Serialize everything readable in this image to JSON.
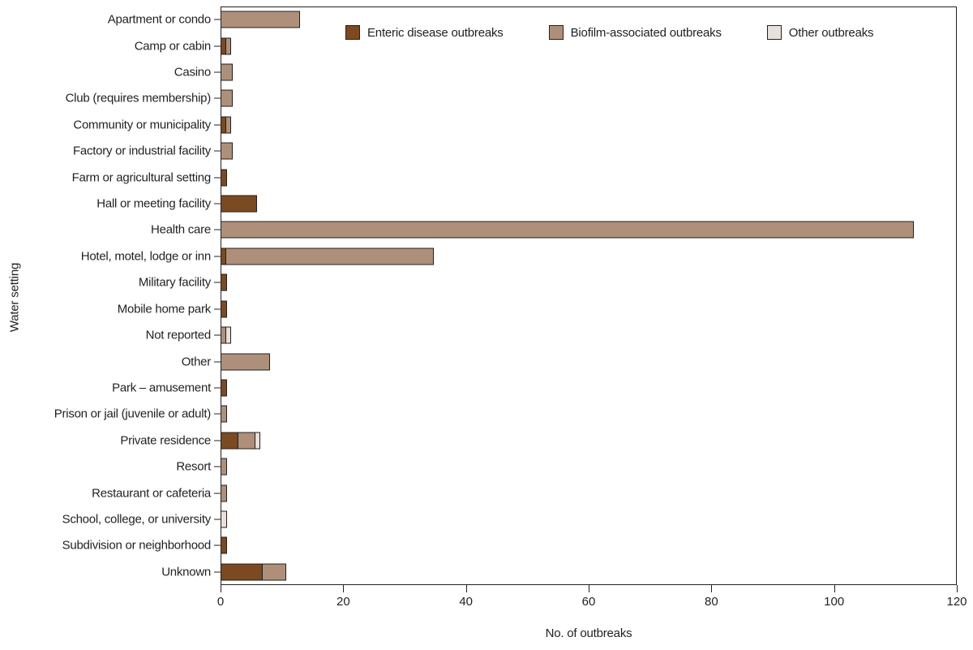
{
  "chart_data": {
    "type": "bar",
    "orientation": "horizontal",
    "stacked": true,
    "title": "",
    "xlabel": "No. of outbreaks",
    "ylabel": "Water setting",
    "xlim": [
      0,
      120
    ],
    "xticks": [
      0,
      20,
      40,
      60,
      80,
      100,
      120
    ],
    "grid": false,
    "legend_position": "top-center",
    "categories": [
      "Apartment or condo",
      "Camp or cabin",
      "Casino",
      "Club (requires membership)",
      "Community or municipality",
      "Factory or industrial facility",
      "Farm or agricultural setting",
      "Hall or meeting facility",
      "Health care",
      "Hotel, motel, lodge or inn",
      "Military facility",
      "Mobile home park",
      "Not reported",
      "Other",
      "Park – amusement",
      "Prison or jail (juvenile or adult)",
      "Private residence",
      "Resort",
      "Restaurant or cafeteria",
      "School, college, or university",
      "Subdivision or neighborhood",
      "Unknown"
    ],
    "series": [
      {
        "name": "Enteric disease outbreaks",
        "color": "#7B4A21",
        "values": [
          0,
          1,
          0,
          0,
          1,
          0,
          1,
          6,
          0,
          1,
          1,
          1,
          0,
          0,
          1,
          0,
          3,
          0,
          0,
          0,
          1,
          7
        ]
      },
      {
        "name": "Biofilm-associated outbreaks",
        "color": "#AE907A",
        "values": [
          13,
          1,
          2,
          2,
          1,
          2,
          0,
          0,
          113,
          34,
          0,
          0,
          1,
          8,
          0,
          1,
          3,
          1,
          1,
          0,
          0,
          4
        ]
      },
      {
        "name": "Other outbreaks",
        "color": "#E8E0DA",
        "values": [
          0,
          0,
          0,
          0,
          0,
          0,
          0,
          0,
          0,
          0,
          0,
          0,
          1,
          0,
          0,
          0,
          1,
          0,
          0,
          1,
          0,
          0
        ]
      }
    ],
    "totals": [
      13,
      2,
      2,
      2,
      2,
      2,
      1,
      6,
      113,
      35,
      1,
      1,
      2,
      8,
      1,
      1,
      7,
      1,
      1,
      1,
      1,
      11
    ]
  },
  "legend": {
    "items": [
      {
        "label": "Enteric disease outbreaks",
        "color": "#7B4A21"
      },
      {
        "label": "Biofilm-associated outbreaks",
        "color": "#AE907A"
      },
      {
        "label": "Other outbreaks",
        "color": "#E8E0DA"
      }
    ]
  },
  "axes": {
    "x_title": "No. of outbreaks",
    "y_title": "Water setting",
    "x_tick_labels": [
      "0",
      "20",
      "40",
      "60",
      "80",
      "100",
      "120"
    ]
  }
}
